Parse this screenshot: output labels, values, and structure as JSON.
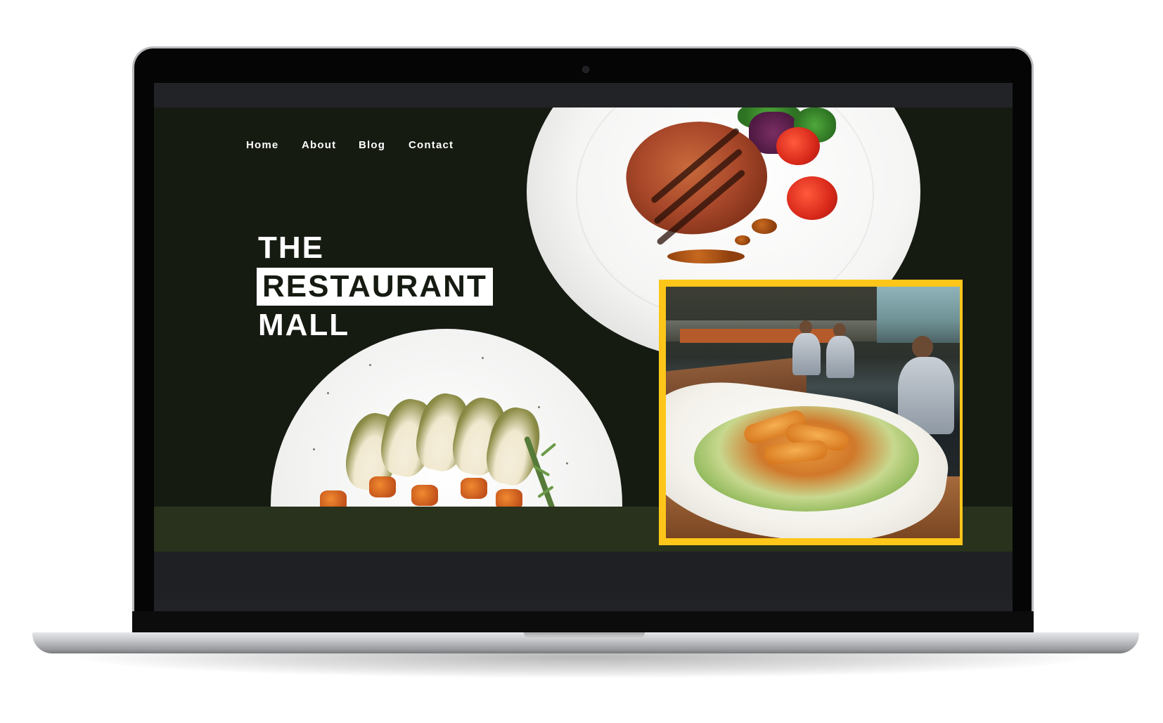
{
  "nav": {
    "items": [
      {
        "label": "Home"
      },
      {
        "label": "About"
      },
      {
        "label": "Blog"
      },
      {
        "label": "Contact"
      }
    ]
  },
  "hero": {
    "line1": "THE",
    "line2": "RESTAURANT",
    "line3": "MALL"
  },
  "colors": {
    "background": "#161b12",
    "accent_frame": "#ffc61a",
    "band": "#29321c",
    "text": "#ffffff"
  },
  "images": {
    "top_plate": "grilled-steak-plate",
    "bottom_plate": "sliced-chicken-plate",
    "featured_photo": "restaurant-interior-with-salad"
  }
}
